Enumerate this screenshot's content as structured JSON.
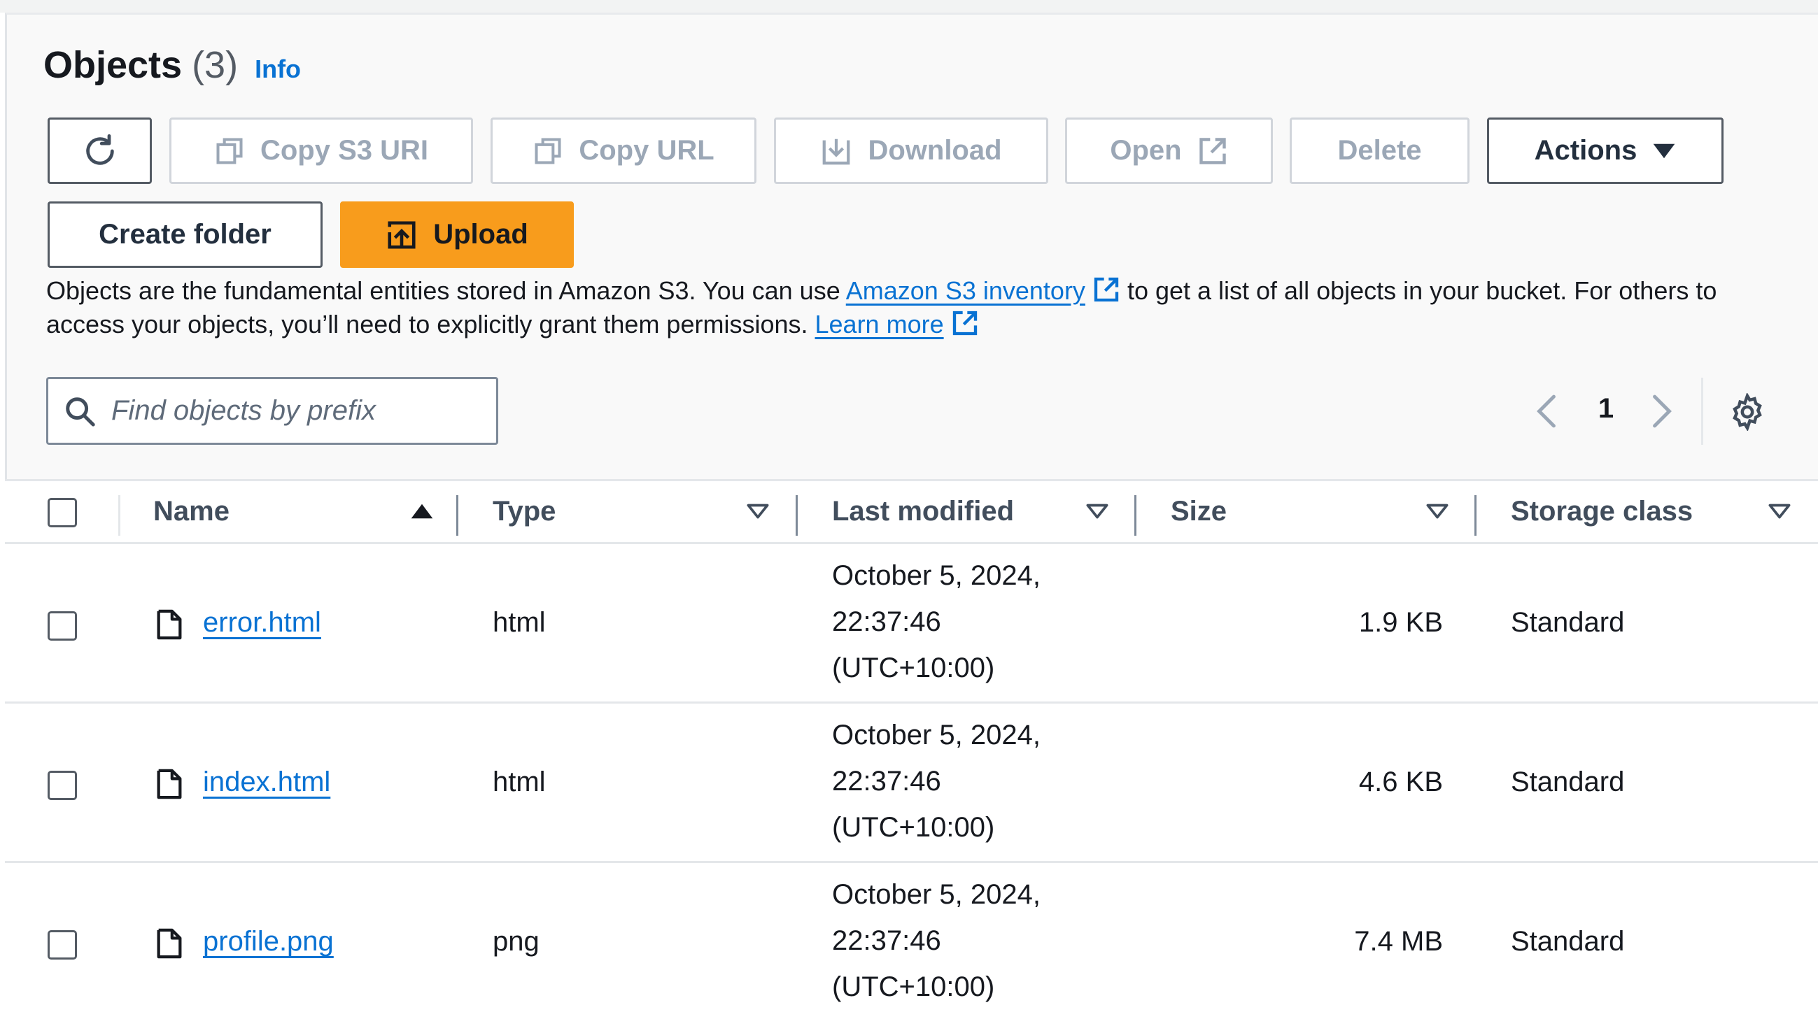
{
  "header": {
    "title": "Objects",
    "count": "(3)",
    "info_label": "Info"
  },
  "toolbar": {
    "copy_s3_uri_label": "Copy S3 URI",
    "copy_url_label": "Copy URL",
    "download_label": "Download",
    "open_label": "Open",
    "delete_label": "Delete",
    "actions_label": "Actions",
    "create_folder_label": "Create folder",
    "upload_label": "Upload"
  },
  "description": {
    "text_before": "Objects are the fundamental entities stored in Amazon S3. You can use ",
    "inventory_link": "Amazon S3 inventory",
    "text_after": " to get a list of all objects in your bucket. For others to access your objects, you’ll need to explicitly grant them permissions. ",
    "learn_more_link": "Learn more"
  },
  "search": {
    "placeholder": "Find objects by prefix",
    "value": ""
  },
  "pagination": {
    "current_page": "1"
  },
  "table": {
    "columns": {
      "name": "Name",
      "type": "Type",
      "last_modified": "Last modified",
      "size": "Size",
      "storage_class": "Storage class"
    },
    "rows": [
      {
        "name": "error.html",
        "type": "html",
        "date_line1": "October 5, 2024,",
        "date_line2": "22:37:46",
        "date_line3": "(UTC+10:00)",
        "size": "1.9 KB",
        "storage_class": "Standard"
      },
      {
        "name": "index.html",
        "type": "html",
        "date_line1": "October 5, 2024,",
        "date_line2": "22:37:46",
        "date_line3": "(UTC+10:00)",
        "size": "4.6 KB",
        "storage_class": "Standard"
      },
      {
        "name": "profile.png",
        "type": "png",
        "date_line1": "October 5, 2024,",
        "date_line2": "22:37:46",
        "date_line3": "(UTC+10:00)",
        "size": "7.4 MB",
        "storage_class": "Standard"
      }
    ]
  },
  "colors": {
    "accent_link": "#0972d3",
    "primary_button": "#f89c1c",
    "disabled_text": "#9ba7b6",
    "panel_background": "#f9f9f9"
  },
  "icons": {
    "refresh": "refresh-icon",
    "copy": "copy-icon",
    "download": "download-icon",
    "external_link": "external-link-icon",
    "caret_down": "caret-down-icon",
    "upload": "upload-icon",
    "search": "search-icon",
    "chevron_left": "chevron-left-icon",
    "chevron_right": "chevron-right-icon",
    "settings": "gear-icon",
    "sort_ascending": "sort-ascending-icon",
    "sort_descending": "sort-descending-icon",
    "file": "file-icon"
  }
}
